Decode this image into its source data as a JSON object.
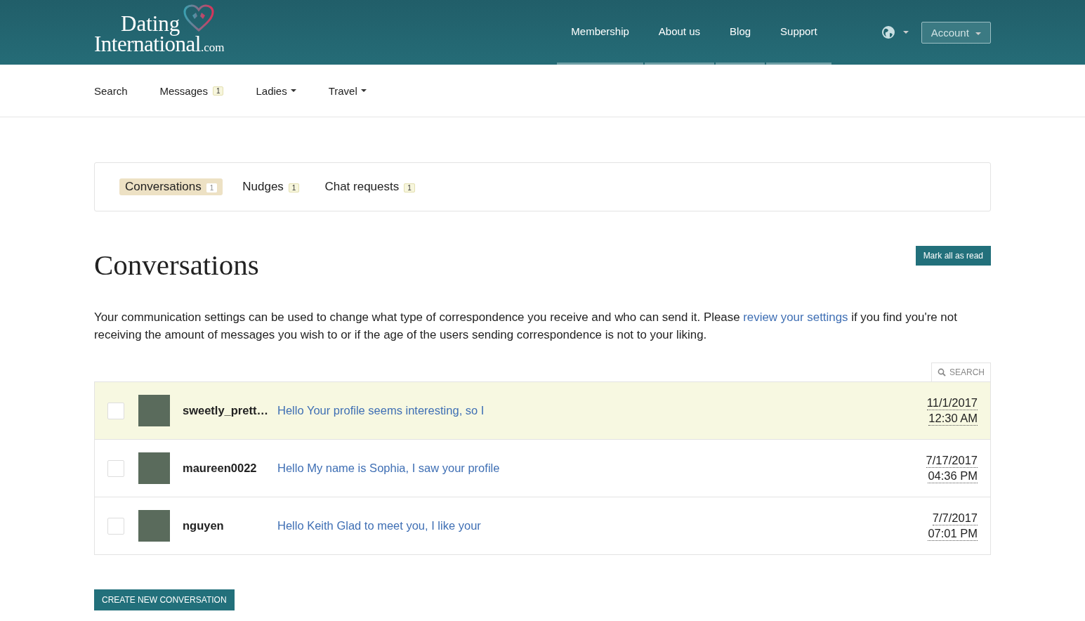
{
  "header": {
    "logo": {
      "line1": "Dating",
      "line2": "International",
      "suffix": ".com"
    },
    "nav": [
      {
        "label": "Membership"
      },
      {
        "label": "About us"
      },
      {
        "label": "Blog"
      },
      {
        "label": "Support"
      }
    ],
    "account": {
      "label": "Account"
    }
  },
  "subnav": [
    {
      "label": "Search",
      "dropdown": false
    },
    {
      "label": "Messages",
      "badge": "1",
      "dropdown": false
    },
    {
      "label": "Ladies",
      "dropdown": true
    },
    {
      "label": "Travel",
      "dropdown": true
    }
  ],
  "tabs": [
    {
      "label": "Conversations",
      "count": "1",
      "selected": true
    },
    {
      "label": "Nudges",
      "count": "1",
      "selected": false
    },
    {
      "label": "Chat requests",
      "count": "1",
      "selected": false
    }
  ],
  "heading": "Conversations",
  "mark_all_button": "Mark all as read",
  "notice": {
    "before": "Your communication settings can be used to change what type of correspondence you receive and who can send it. Please ",
    "link": "review your settings",
    "after": " if you find you're not receiving the amount of messages you wish to or if the age of the users sending correspondence is not to your liking."
  },
  "search_button": "SEARCH",
  "conversations": [
    {
      "checked": false,
      "unread": true,
      "username": "sweetly_prett…",
      "preview": "Hello Your profile seems interesting, so I",
      "date": "11/1/2017",
      "time": "12:30 AM"
    },
    {
      "checked": false,
      "unread": false,
      "username": "maureen0022",
      "preview": "Hello My name is Sophia, I saw your profile",
      "date": "7/17/2017",
      "time": "04:36 PM"
    },
    {
      "checked": false,
      "unread": false,
      "username": "nguyen",
      "preview": "Hello Keith Glad to meet you, I like your",
      "date": "7/7/2017",
      "time": "07:01 PM"
    }
  ],
  "create_button": "CREATE NEW CONVERSATION"
}
